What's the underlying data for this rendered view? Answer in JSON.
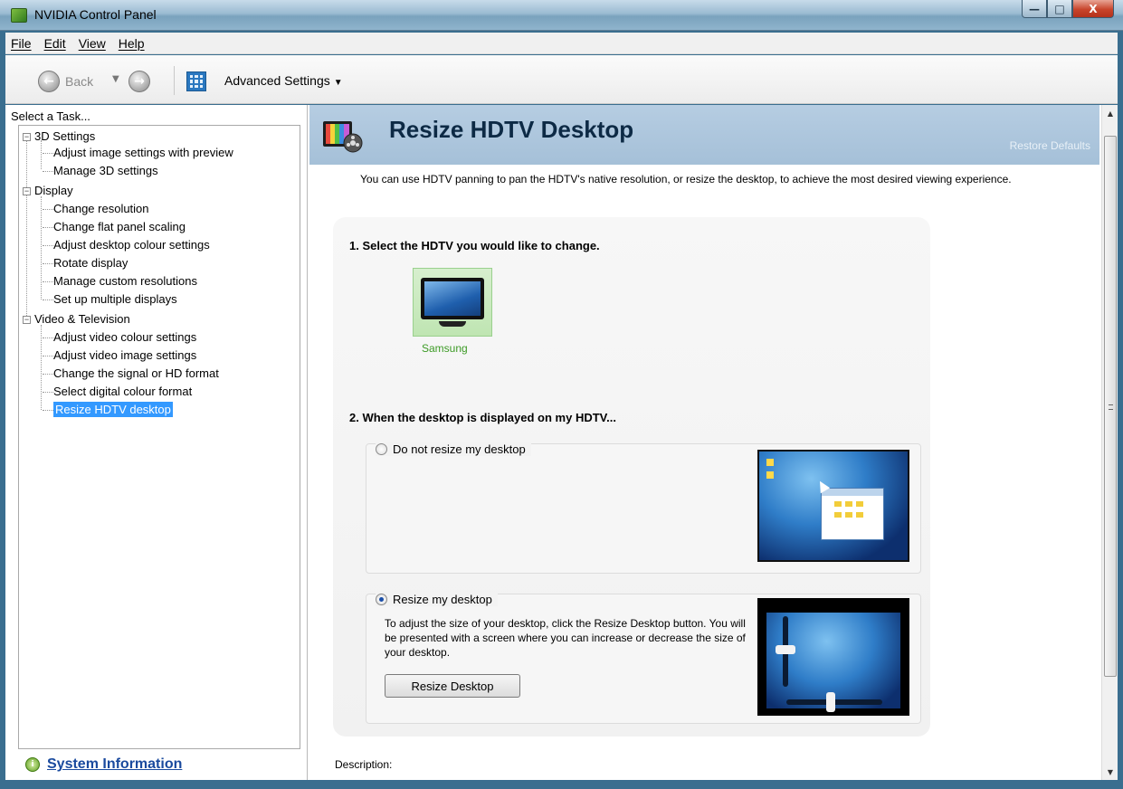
{
  "window": {
    "title": "NVIDIA Control Panel",
    "minimize_glyph": "—",
    "maximize_glyph": "□",
    "close_glyph": "X"
  },
  "menubar": {
    "items": [
      "File",
      "Edit",
      "View",
      "Help"
    ]
  },
  "toolbar": {
    "back_label": "Back",
    "advanced_settings_label": "Advanced Settings"
  },
  "tasks": {
    "header": "Select a Task...",
    "categories": [
      {
        "label": "3D Settings",
        "items": [
          "Adjust image settings with preview",
          "Manage 3D settings"
        ]
      },
      {
        "label": "Display",
        "items": [
          "Change resolution",
          "Change flat panel scaling",
          "Adjust desktop colour settings",
          "Rotate display",
          "Manage custom resolutions",
          "Set up multiple displays"
        ]
      },
      {
        "label": "Video & Television",
        "items": [
          "Adjust video colour settings",
          "Adjust video image settings",
          "Change the signal or HD format",
          "Select digital colour format",
          "Resize HDTV desktop"
        ]
      }
    ],
    "selected": "Resize HDTV desktop",
    "system_information": "System Information"
  },
  "page": {
    "title": "Resize HDTV Desktop",
    "restore_defaults": "Restore Defaults",
    "intro": "You can use HDTV panning to pan the HDTV's native resolution, or resize the desktop, to achieve the most desired viewing experience.",
    "step1": "1. Select the HDTV you would like to change.",
    "display_name": "Samsung",
    "step2": "2. When the desktop is displayed on my HDTV...",
    "option1_label": "Do not resize my desktop",
    "option1_selected": false,
    "option2_label": "Resize my desktop",
    "option2_selected": true,
    "option2_description": "To adjust the size of your desktop, click the Resize Desktop button.  You will be presented with a screen where you can increase or decrease the size of your desktop.",
    "resize_button": "Resize Desktop",
    "description_label": "Description:"
  },
  "colors": {
    "banner": "#a5c0d8",
    "selection": "#3399ff",
    "display_name": "#3d9b26",
    "link": "#1a4a9e"
  }
}
